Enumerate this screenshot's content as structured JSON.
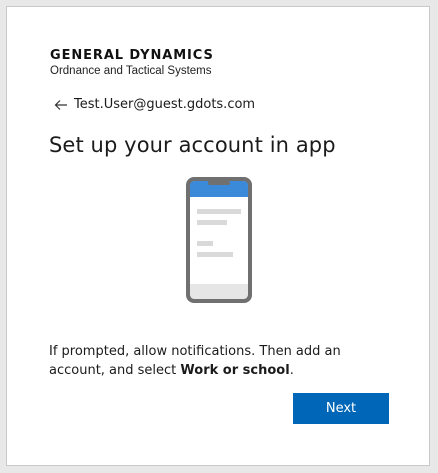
{
  "brand": {
    "name": "GENERAL DYNAMICS",
    "subtitle": "Ordnance and Tactical Systems"
  },
  "identity": {
    "back_icon": "back-arrow-icon",
    "email": "Test.User@guest.gdots.com"
  },
  "page": {
    "title": "Set up your account in app"
  },
  "illustration": {
    "icon": "smartphone-illustration",
    "accent_color": "#3b8ad9",
    "frame_color": "#6f6f6f"
  },
  "description": {
    "text_before": "If prompted, allow notifications. Then add an account, and select ",
    "emphasis": "Work or school",
    "text_after": "."
  },
  "actions": {
    "next_label": "Next",
    "next_color": "#0067b8"
  }
}
